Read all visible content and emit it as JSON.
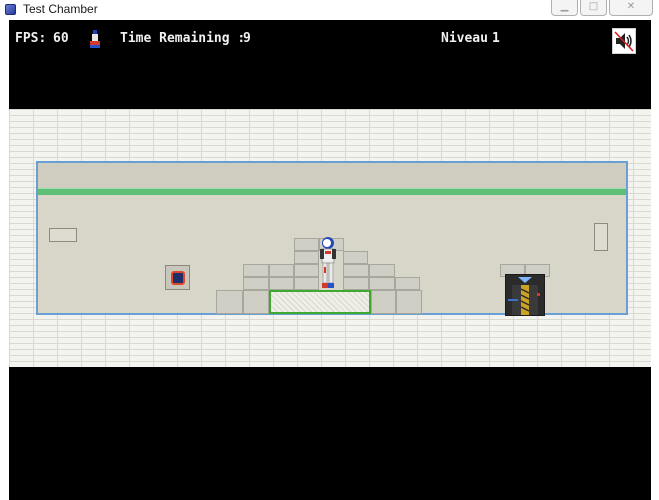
{
  "window": {
    "title": "Test Chamber",
    "icon": "app-icon",
    "controls": [
      "minimize-icon",
      "maximize-icon",
      "close-icon"
    ],
    "control_glyphs": {
      "minimize": "▁",
      "maximize": "□",
      "close": "✕"
    }
  },
  "hud": {
    "fps_label": "FPS:",
    "fps_value": "60",
    "time_label": "Time Remaining :",
    "time_value": "9",
    "level_label": "Niveau",
    "level_value": "1",
    "sound_icon": "speaker-muted-icon"
  },
  "colors": {
    "background": "#000000",
    "hud_text": "#f0f0f0",
    "room_border": "#6a9fd4",
    "ceiling_stripe": "#5fbf76",
    "pressure_plate": "#3fa82f",
    "switch_border": "#e2462a"
  }
}
